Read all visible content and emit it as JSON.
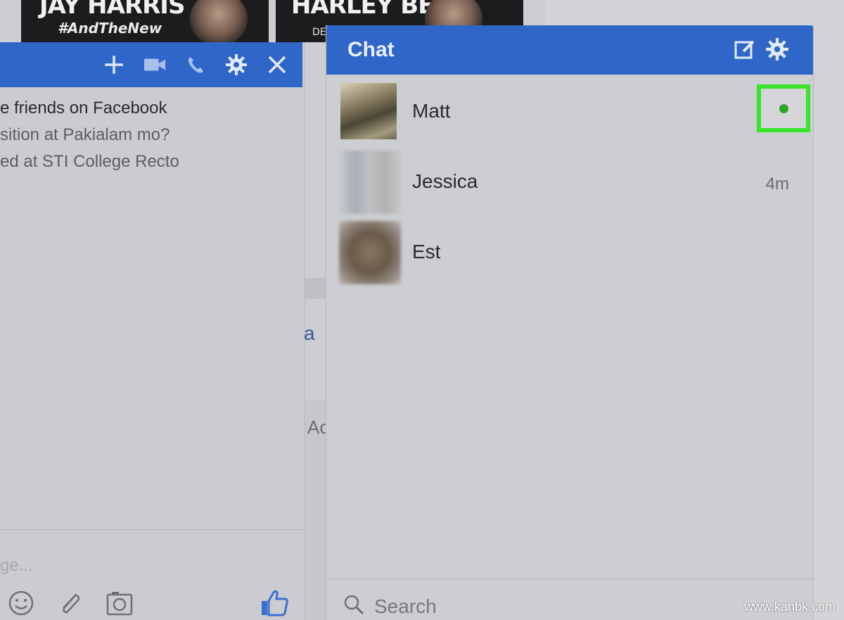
{
  "posters": [
    {
      "title": "JAY HARRIS",
      "subtitle": "#AndTheNew"
    },
    {
      "title": "HARLEY BENN",
      "tag": "DE"
    }
  ],
  "conversation": {
    "messages": [
      "e friends on Facebook",
      "sition at Pakialam mo?",
      "ed at STI College Recto"
    ],
    "input_placeholder": "ge..."
  },
  "middle": {
    "fragment_link": "a",
    "fragment_ad": "Ac"
  },
  "chat": {
    "title": "Chat",
    "contacts": [
      {
        "name": "Matt",
        "status": "online"
      },
      {
        "name": "Jessica",
        "meta": "4m"
      },
      {
        "name": "Est",
        "meta": ""
      }
    ],
    "search_placeholder": "Search"
  },
  "colors": {
    "header_blue": "#3166c9",
    "online_green": "#2fa52b",
    "highlight_green": "#3ae42a",
    "like_blue": "#3b6fd2"
  },
  "watermark": "www.kanbk.com"
}
